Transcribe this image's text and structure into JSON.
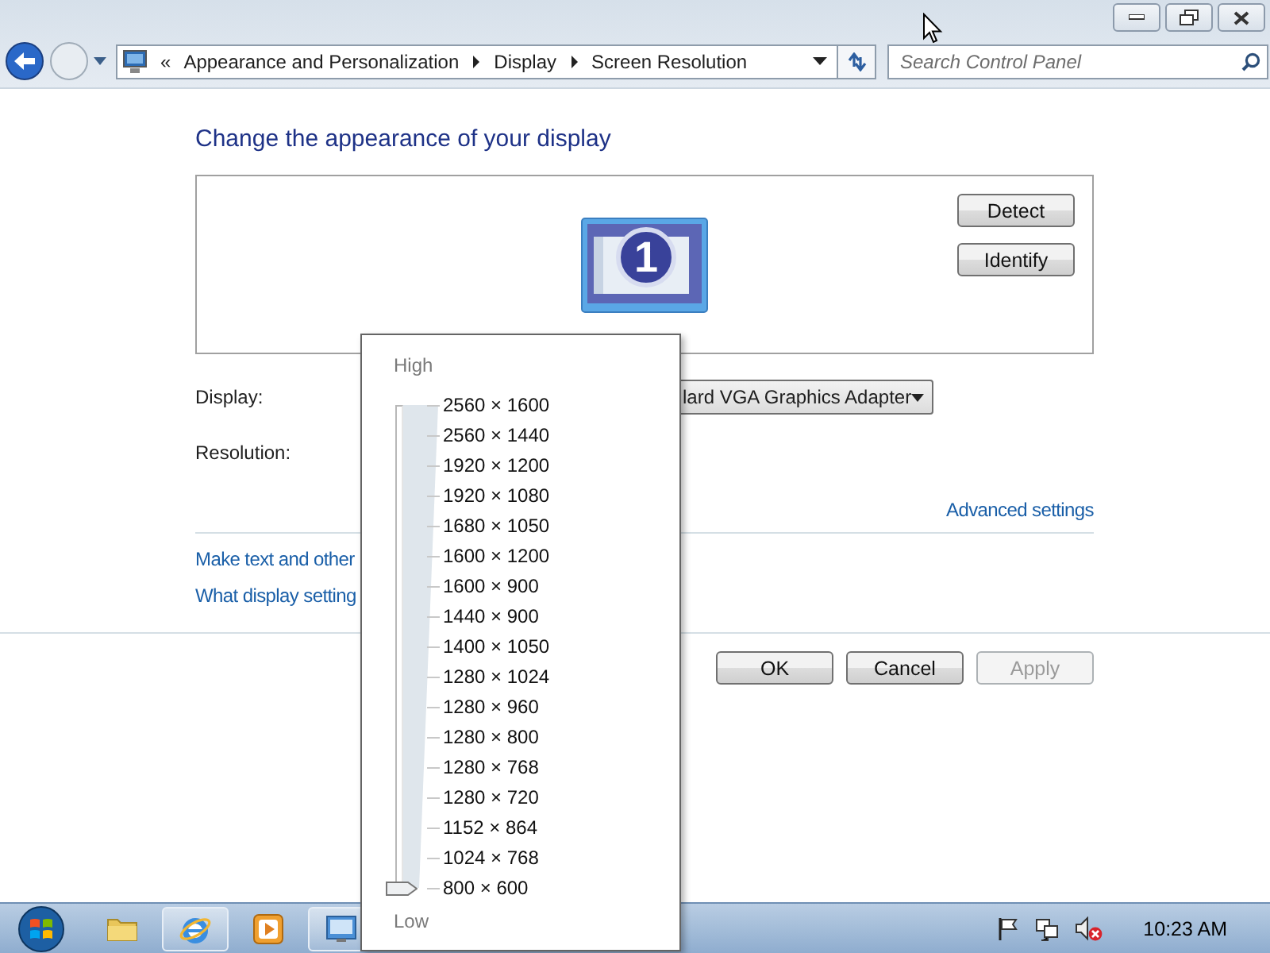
{
  "address_bar": {
    "overflow": "«",
    "crumbs": [
      "Appearance and Personalization",
      "Display",
      "Screen Resolution"
    ]
  },
  "search": {
    "placeholder": "Search Control Panel"
  },
  "heading": "Change the appearance of your display",
  "monitor": {
    "number": "1"
  },
  "side_buttons": [
    "Detect",
    "Identify"
  ],
  "display": {
    "label": "Display:",
    "value": "lard VGA Graphics Adapter"
  },
  "resolution": {
    "label": "Resolution:"
  },
  "advanced_link": "Advanced settings",
  "links": [
    "Make text and other",
    "What display setting"
  ],
  "buttons": [
    {
      "label": "OK",
      "disabled": false
    },
    {
      "label": "Cancel",
      "disabled": false
    },
    {
      "label": "Apply",
      "disabled": true
    }
  ],
  "resolution_popup": {
    "high": "High",
    "low": "Low",
    "level": 0,
    "options": [
      "2560 × 1600",
      "2560 × 1440",
      "1920 × 1200",
      "1920 × 1080",
      "1680 × 1050",
      "1600 × 1200",
      "1600 × 900",
      "1440 × 900",
      "1400 × 1050",
      "1280 × 1024",
      "1280 × 960",
      "1280 × 800",
      "1280 × 768",
      "1280 × 720",
      "1152 × 864",
      "1024 × 768",
      "800 × 600"
    ]
  },
  "taskbar": {
    "apps": [
      {
        "kind": "folder",
        "active": false
      },
      {
        "kind": "browser",
        "active": true
      },
      {
        "kind": "media",
        "active": false
      },
      {
        "kind": "display",
        "active": true
      }
    ],
    "clock": "10:23 AM"
  }
}
